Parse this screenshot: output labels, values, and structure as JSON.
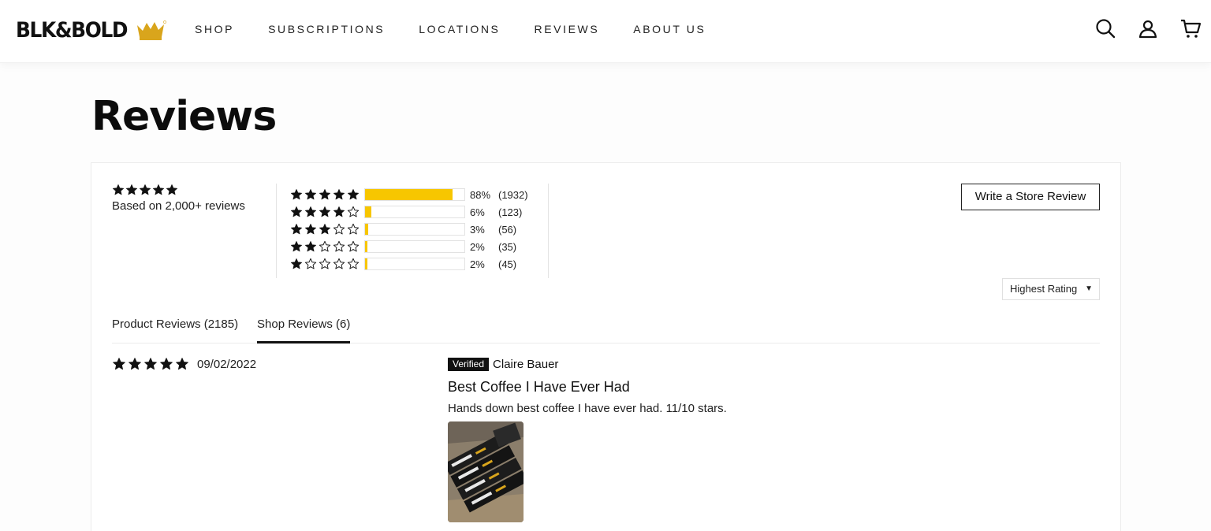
{
  "brand": {
    "name": "BLK&BOLD",
    "accent_color": "#f7c600",
    "logo_icon": "crown-icon"
  },
  "nav": {
    "items": [
      "SHOP",
      "SUBSCRIPTIONS",
      "LOCATIONS",
      "REVIEWS",
      "ABOUT US"
    ]
  },
  "header_icons": [
    "search-icon",
    "account-icon",
    "cart-icon"
  ],
  "page": {
    "title": "Reviews"
  },
  "summary": {
    "average_stars": 5,
    "text": "Based on 2,000+ reviews"
  },
  "histogram": [
    {
      "stars": 5,
      "percent_label": "88%",
      "count_label": "(1932)",
      "fill": 0.88
    },
    {
      "stars": 4,
      "percent_label": "6%",
      "count_label": "(123)",
      "fill": 0.06
    },
    {
      "stars": 3,
      "percent_label": "3%",
      "count_label": "(56)",
      "fill": 0.03
    },
    {
      "stars": 2,
      "percent_label": "2%",
      "count_label": "(35)",
      "fill": 0.02
    },
    {
      "stars": 1,
      "percent_label": "2%",
      "count_label": "(45)",
      "fill": 0.02
    }
  ],
  "actions": {
    "write_review_label": "Write a Store Review",
    "sort_label": "Highest Rating",
    "sort_caret": "▼"
  },
  "tabs": [
    {
      "label": "Product Reviews (2185)",
      "active": false
    },
    {
      "label": "Shop Reviews (6)",
      "active": true
    }
  ],
  "reviews": [
    {
      "stars": 5,
      "date": "09/02/2022",
      "badge": "Verified",
      "author": "Claire Bauer",
      "title": "Best Coffee I Have Ever Had",
      "body": "Hands down best coffee I have ever had. 11/10 stars."
    }
  ]
}
